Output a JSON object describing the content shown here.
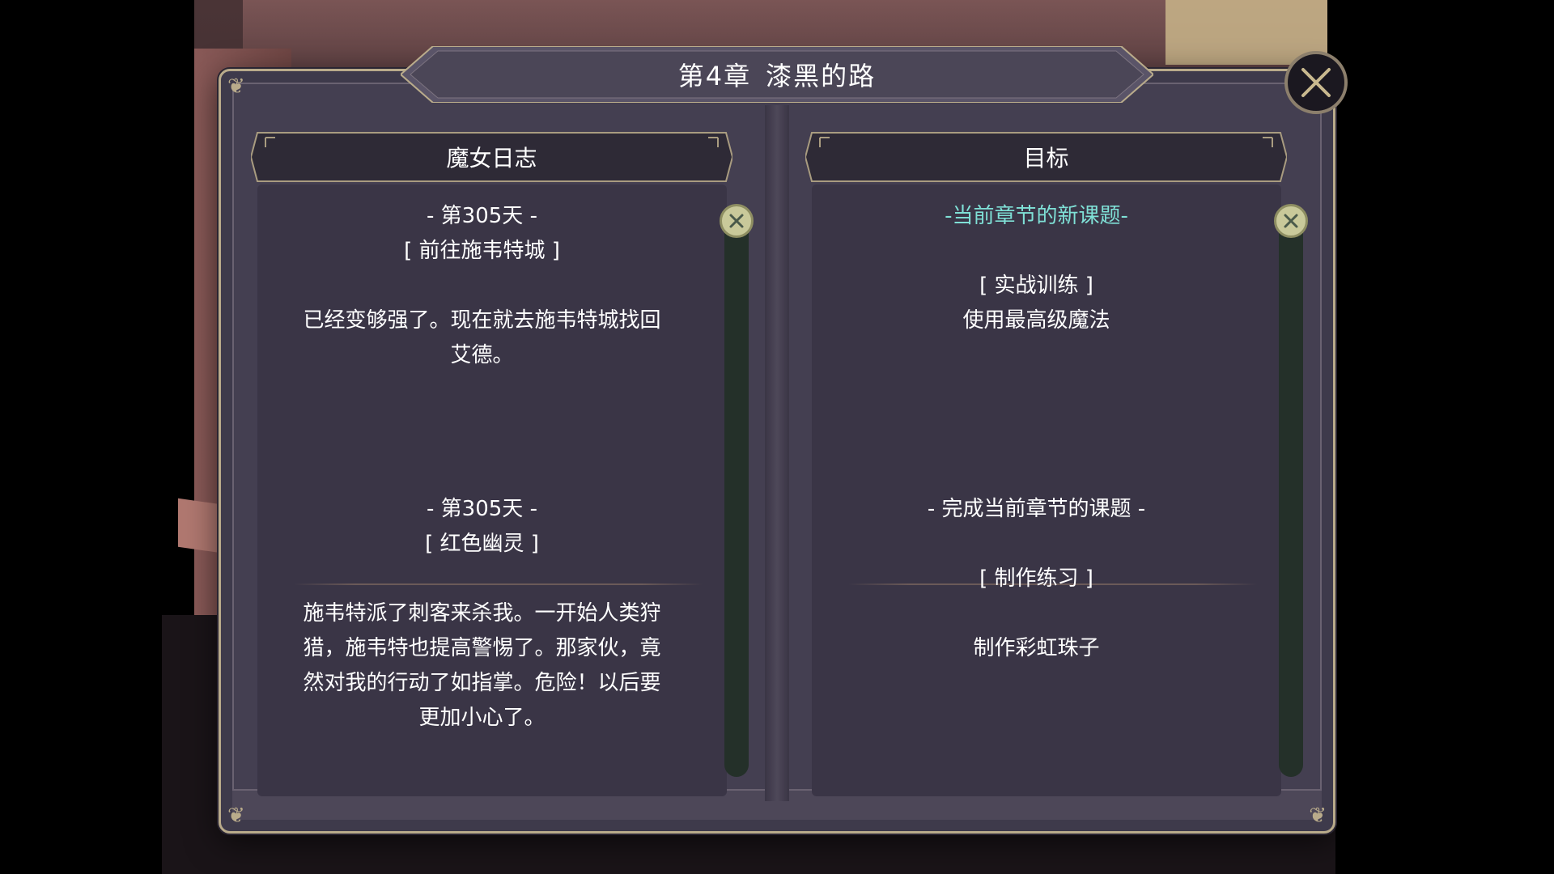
{
  "title": {
    "chapter": "第4章",
    "name": "漆黑的路"
  },
  "left_panel": {
    "header": "魔女日志",
    "entries": [
      {
        "day": "- 第305天 -",
        "subtitle": "[ 前往施韦特城 ]",
        "body_lines": [
          "已经变够强了。现在就去施韦特城找回",
          "艾德。"
        ]
      },
      {
        "day": "- 第305天 -",
        "subtitle": "[ 红色幽灵 ]",
        "body_lines": [
          "施韦特派了刺客来杀我。一开始人类狩",
          "猎，施韦特也提高警惕了。那家伙，竟",
          "然对我的行动了如指掌。危险！以后要",
          "更加小心了。"
        ]
      }
    ]
  },
  "right_panel": {
    "header": "目标",
    "entries": [
      {
        "heading": "-当前章节的新课题-",
        "task": "[ 实战训练 ]",
        "description": "使用最高级魔法"
      },
      {
        "heading": "- 完成当前章节的课题 -",
        "task": "[ 制作练习 ]",
        "description": "制作彩虹珠子"
      }
    ]
  },
  "colors": {
    "accent_heading": "#7fe0d6",
    "frame_gold": "#b9ab8b",
    "panel_bg": "#3a3546"
  },
  "icons": {
    "close": "close-icon",
    "scroll_left": "scroll-handle-icon",
    "scroll_right": "scroll-handle-icon"
  }
}
